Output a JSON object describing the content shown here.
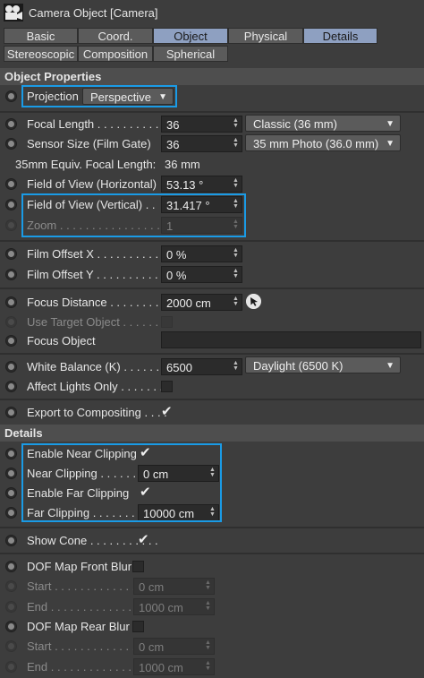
{
  "window": {
    "title": "Camera Object [Camera]"
  },
  "icons": {
    "app": "camera-icon",
    "pick": "pick-arrow-icon"
  },
  "tabs": [
    "Basic",
    "Coord.",
    "Object",
    "Physical",
    "Details",
    "Stereoscopic",
    "Composition",
    "Spherical"
  ],
  "sections": {
    "object_properties": "Object Properties",
    "details": "Details"
  },
  "props": {
    "projection": {
      "label": "Projection",
      "value": "Perspective"
    },
    "focal_length": {
      "label": "Focal Length . . . . . . . . . .",
      "value": "36",
      "preset": "Classic (36 mm)"
    },
    "sensor_size": {
      "label": "Sensor Size (Film Gate)",
      "value": "36",
      "preset": "35 mm Photo (36.0 mm)"
    },
    "equiv_focal": {
      "label": "35mm Equiv. Focal Length:",
      "value": "36 mm"
    },
    "fov_h": {
      "label": "Field of View (Horizontal)",
      "value": "53.13 °"
    },
    "fov_v": {
      "label": "Field of View (Vertical) . .",
      "value": "31.417 °"
    },
    "zoom": {
      "label": "Zoom . . . . . . . . . . . . . . . .",
      "value": "1"
    },
    "film_offset_x": {
      "label": "Film Offset X . . . . . . . . . .",
      "value": "0 %"
    },
    "film_offset_y": {
      "label": "Film Offset Y . . . . . . . . . .",
      "value": "0 %"
    },
    "focus_distance": {
      "label": "Focus Distance . . . . . . . .",
      "value": "2000 cm"
    },
    "use_target": {
      "label": "Use Target Object . . . . . . ."
    },
    "focus_object": {
      "label": "Focus Object",
      "value": ""
    },
    "white_balance": {
      "label": "White Balance (K) . . . . . . .",
      "value": "6500",
      "preset": "Daylight (6500 K)"
    },
    "affect_lights": {
      "label": "Affect Lights Only . . . . . . ."
    },
    "export_comp": {
      "label": "Export to Compositing . . . ."
    }
  },
  "details": {
    "enable_near": {
      "label": "Enable Near Clipping"
    },
    "near_clipping": {
      "label": "Near Clipping . . . . . . . .",
      "value": "0 cm"
    },
    "enable_far": {
      "label": "Enable Far Clipping"
    },
    "far_clipping": {
      "label": "Far Clipping . . . . . . . . .",
      "value": "10000 cm"
    },
    "show_cone": {
      "label": "Show Cone . . . . . . . . . . ."
    },
    "dof_front": {
      "label": "DOF Map Front Blur"
    },
    "front_start": {
      "label": "Start . . . . . . . . . . . . . . .",
      "value": "0 cm"
    },
    "front_end": {
      "label": "End . . . . . . . . . . . . . . . .",
      "value": "1000 cm"
    },
    "dof_rear": {
      "label": "DOF Map Rear Blur"
    },
    "rear_start": {
      "label": "Start . . . . . . . . . . . . . . .",
      "value": "0 cm"
    },
    "rear_end": {
      "label": "End . . . . . . . . . . . . . . . .",
      "value": "1000 cm"
    }
  },
  "glyphs": {
    "check": "✔",
    "caret": "▼",
    "spin_up": "▲",
    "spin_down": "▼"
  },
  "colors": {
    "highlight": "#1a9be6",
    "active_tab": "#8ea0c1",
    "background": "#3d3d3d"
  }
}
